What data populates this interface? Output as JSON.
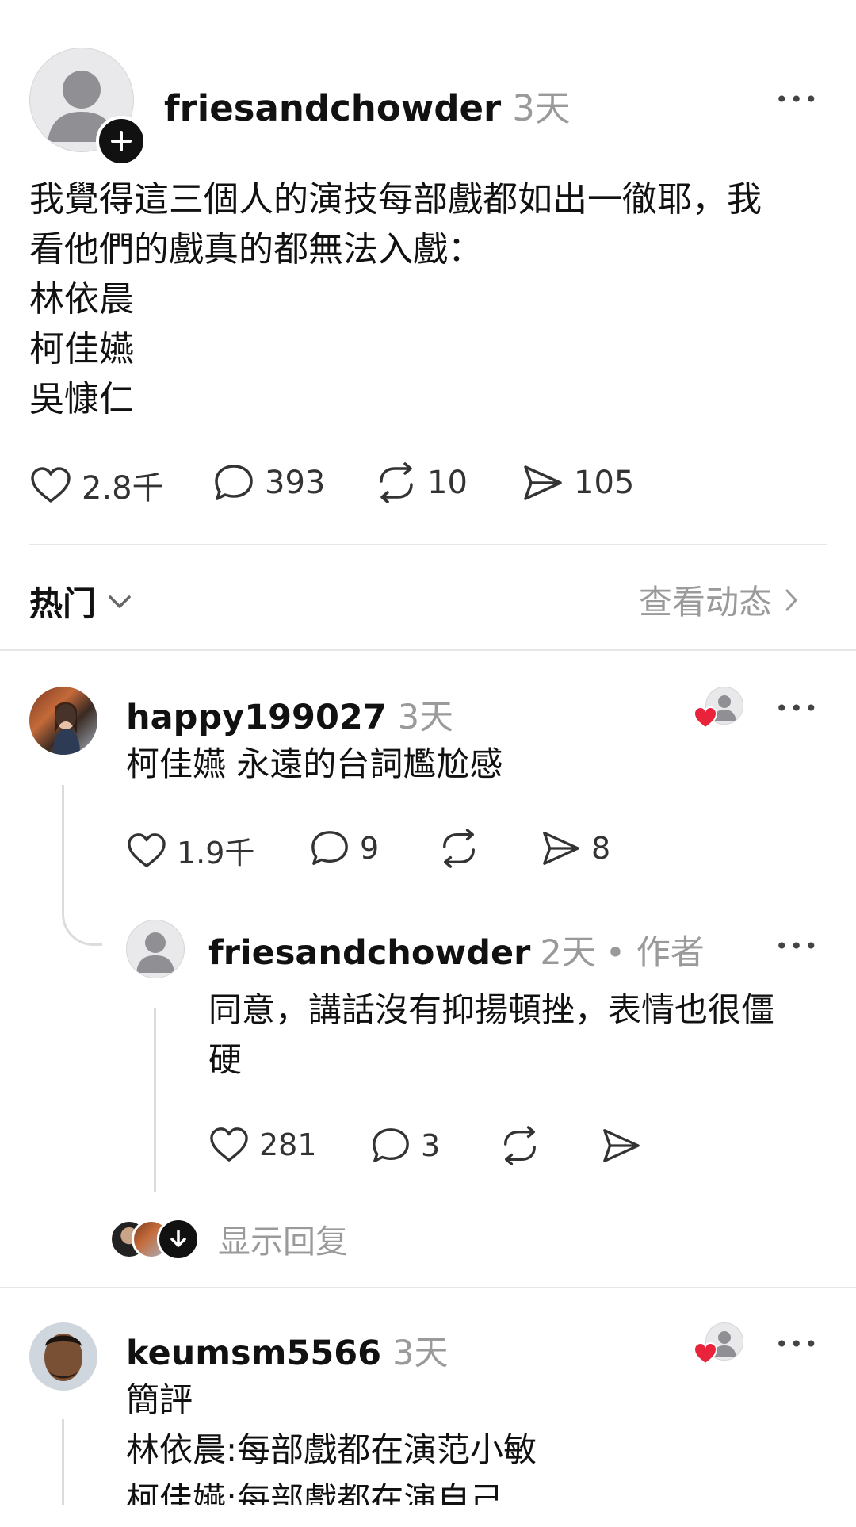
{
  "post": {
    "username": "friesandchowder",
    "time": "3天",
    "text": "我覺得這三個人的演技每部戲都如出一徹耶，我\n看他們的戲真的都無法入戲：\n林依晨\n柯佳嬿\n吳慷仁",
    "likes": "2.8千",
    "comments": "393",
    "reposts": "10",
    "shares": "105",
    "more": "•••"
  },
  "filter": {
    "sort_label": "热门",
    "activity_label": "查看动态"
  },
  "comments": [
    {
      "username": "happy199027",
      "time": "3天",
      "text": "柯佳嬿 永遠的台詞尷尬感",
      "likes": "1.9千",
      "comments": "9",
      "shares": "8",
      "more": "•••",
      "reply": {
        "username": "friesandchowder",
        "time": "2天",
        "author_tag": "• 作者",
        "text": "同意，講話沒有抑揚頓挫，表情也很僵\n硬",
        "likes": "281",
        "comments": "3",
        "more": "•••"
      },
      "show_replies": "显示回复"
    },
    {
      "username": "keumsm5566",
      "time": "3天",
      "text": "簡評\n林依晨:每部戲都在演范小敏\n柯佳嬿:每部戲都在演自己",
      "more": "•••"
    }
  ],
  "colors": {
    "accent_heart": "#e8233a",
    "muted": "#9a9a9a",
    "divider": "#e6e6e6"
  },
  "icons": [
    "heart-icon",
    "comment-icon",
    "repost-icon",
    "share-icon",
    "chevron-down-icon",
    "chevron-right-icon",
    "plus-icon",
    "more-icon"
  ]
}
